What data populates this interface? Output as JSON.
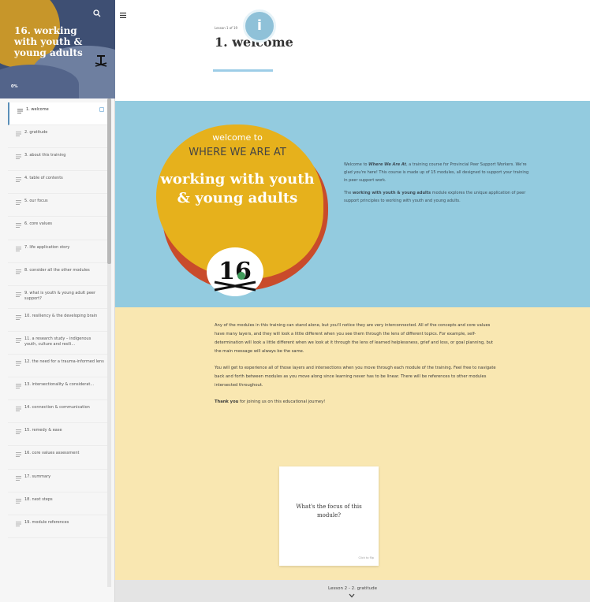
{
  "sidebar": {
    "course_title": "16. working with youth & young adults",
    "progress": "0%",
    "items": [
      {
        "label": "1. welcome"
      },
      {
        "label": "2. gratitude"
      },
      {
        "label": "3. about this training"
      },
      {
        "label": "4. table of contents"
      },
      {
        "label": "5. our focus"
      },
      {
        "label": "6. core values"
      },
      {
        "label": "7. life application story"
      },
      {
        "label": "8. consider all the other modules"
      },
      {
        "label": "9. what is youth & young adult peer support?"
      },
      {
        "label": "10. resiliency & the developing brain"
      },
      {
        "label": "11. a research study – indigenous youth, culture and resili..."
      },
      {
        "label": "12. the need for a trauma-informed lens"
      },
      {
        "label": "13. intersectionality & considerat..."
      },
      {
        "label": "14. connection & communication"
      },
      {
        "label": "15. remedy & ease"
      },
      {
        "label": "16. core values assessment"
      },
      {
        "label": "17. summary"
      },
      {
        "label": "18. next steps"
      },
      {
        "label": "19. module references"
      }
    ]
  },
  "lesson": {
    "count": "Lesson 1 of 19",
    "title": "1. welcome",
    "info_badge": "i"
  },
  "hero": {
    "welcome_to": "welcome to",
    "brand": "WHERE WE ARE AT",
    "module_name": "working with youth & young adults",
    "logo_number": "16"
  },
  "intro": {
    "p1_a": "Welcome to ",
    "p1_em": "Where We Are At",
    "p1_b": ", a training course for Provincial Peer Support Workers. We're glad you're here! This course is made up of 15 modules, all designed to support your training in peer support work.",
    "p2_a": "The ",
    "p2_strong": "working with youth & young adults",
    "p2_b": " module explores the unique application of peer support principles to working with youth and young adults."
  },
  "body": {
    "p1": "Any of the modules in this training can stand alone, but you'll notice they are very interconnected. All of the concepts and core values have many layers, and they will look a little different when you see them through the lens of different topics. For example, self-determination will look a little different when we look at it through the lens of learned helplessness, grief and loss, or goal planning, but the main message will always be the same.",
    "p2": "You will get to experience all of those layers and intersections when you move through each module of the training. Feel free to navigate back and forth between modules as you move along since learning never has to be linear. There will be references to other modules intersected throughout.",
    "p3_strong": "Thank you",
    "p3_rest": " for joining us on this educational journey!"
  },
  "flashcard": {
    "question": "What's the focus of this module?",
    "flip_label": "Click to flip"
  },
  "footer": {
    "next_label": "Lesson 2 - 2. gratitude"
  },
  "colors": {
    "blue_band": "#93cbdf",
    "yellow_band": "#f9e7b1",
    "accent": "#e6b11c",
    "blob_shadow": "#c94b2b"
  }
}
